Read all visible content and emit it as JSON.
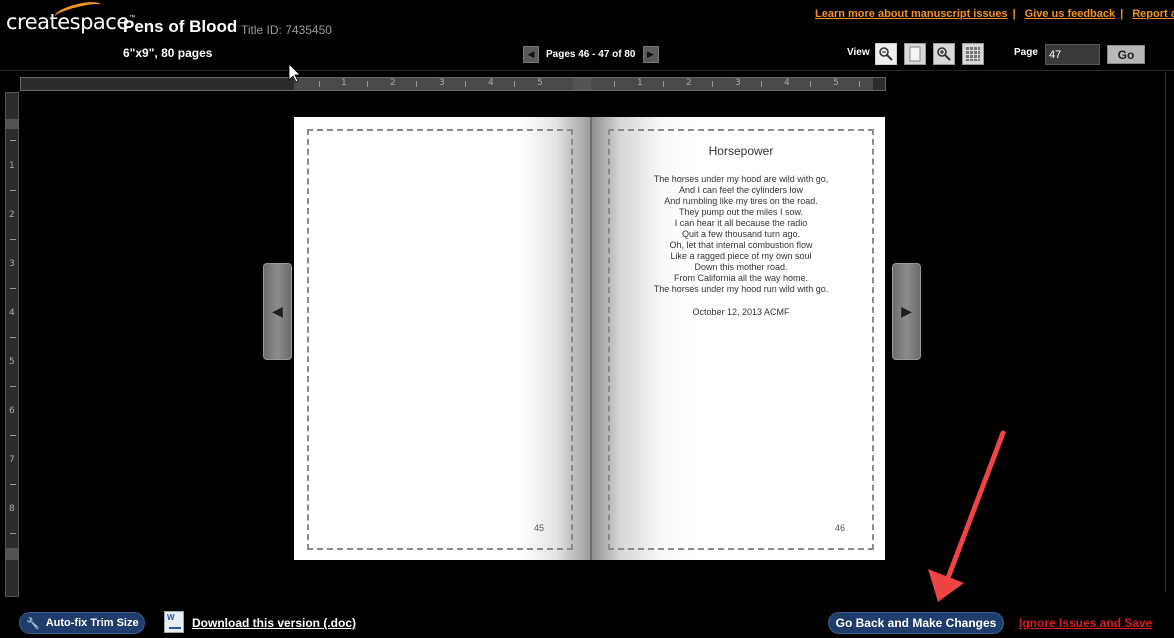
{
  "brand": {
    "logo_text": "createspace",
    "trademark": "™"
  },
  "header": {
    "title": "Pens of Blood",
    "title_id": "Title ID: 7435450",
    "trim_info": "6\"x9\", 80 pages"
  },
  "top_links": [
    {
      "label": "Learn more about manuscript issues"
    },
    {
      "label": "Give us feedback"
    },
    {
      "label": "Report a"
    }
  ],
  "pager": {
    "text": "Pages 46 - 47 of 80",
    "prev_icon": "chevron-left-icon",
    "next_icon": "chevron-right-icon"
  },
  "view": {
    "label": "View",
    "modes": [
      {
        "name": "zoom-fit-icon"
      },
      {
        "name": "single-page-icon"
      },
      {
        "name": "zoom-in-icon"
      },
      {
        "name": "grid-view-icon"
      }
    ]
  },
  "page_jump": {
    "label": "Page",
    "value": "47",
    "go_label": "Go"
  },
  "ruler": {
    "h_numbers_left": [
      "1",
      "2",
      "3",
      "4",
      "5"
    ],
    "h_numbers_right": [
      "1",
      "2",
      "3",
      "4",
      "5"
    ],
    "v_numbers": [
      "1",
      "2",
      "3",
      "4",
      "5",
      "6",
      "7",
      "8"
    ]
  },
  "book": {
    "left_page_number": "45",
    "right_page_number": "46",
    "poem_title": "Horsepower",
    "poem_lines": [
      "The horses under my hood are wild with go,",
      "And I can feel the cylinders low",
      "And rumbling like my tires on the road.",
      "They pump out the miles I sow.",
      "I can hear it all because the radio",
      "Quit a few thousand turn ago.",
      "Oh, let that internal combustion flow",
      "Like a ragged piece of my own soul",
      "Down this mother road.",
      "From California all the way home.",
      "The horses under my hood run wild with go."
    ],
    "poem_date": "October 12, 2013 ACMF"
  },
  "footer": {
    "autofix_label": "Auto-fix Trim Size",
    "download_label": "Download this version (.doc)",
    "doc_icon_letter": "W",
    "goback_label": "Go Back and Make Changes",
    "ignore_label": "Ignore Issues and Save"
  },
  "colors": {
    "accent_orange": "#f7941d",
    "button_blue": "#1e3d6a",
    "ignore_red": "#d81e1e",
    "annotation_arrow": "#ef4444"
  }
}
